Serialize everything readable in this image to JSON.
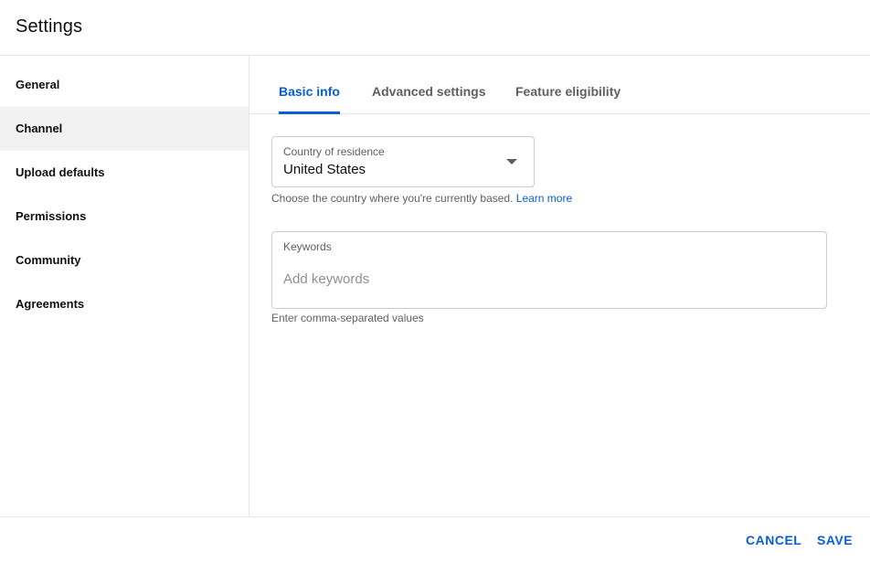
{
  "header": {
    "title": "Settings"
  },
  "sidebar": {
    "items": [
      {
        "label": "General"
      },
      {
        "label": "Channel",
        "active": true
      },
      {
        "label": "Upload defaults"
      },
      {
        "label": "Permissions"
      },
      {
        "label": "Community"
      },
      {
        "label": "Agreements"
      }
    ]
  },
  "tabs": [
    {
      "label": "Basic info",
      "active": true
    },
    {
      "label": "Advanced settings"
    },
    {
      "label": "Feature eligibility"
    }
  ],
  "country": {
    "label": "Country of residence",
    "value": "United States",
    "helper": "Choose the country where you're currently based.",
    "link": "Learn more"
  },
  "keywords": {
    "label": "Keywords",
    "placeholder": "Add keywords",
    "value": "",
    "helper": "Enter comma-separated values"
  },
  "footer": {
    "cancel": "CANCEL",
    "save": "SAVE"
  },
  "colors": {
    "accent": "#065fd4",
    "active_bg": "#f1f1f1",
    "border": "#e5e5e5"
  }
}
